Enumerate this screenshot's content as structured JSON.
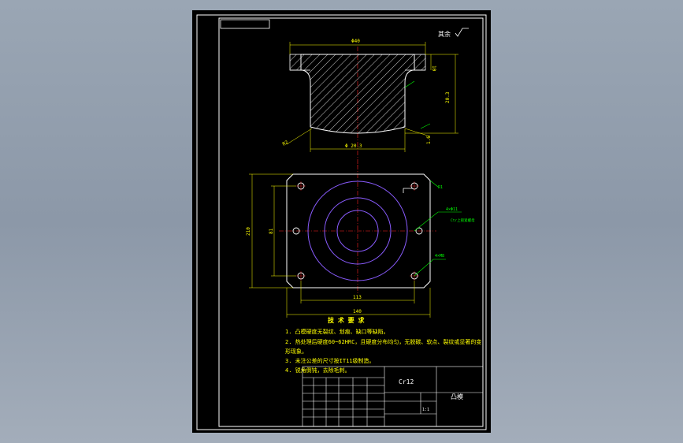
{
  "colors": {
    "background": "#8f9bab",
    "paper": "#000000",
    "frame": "#ffffff",
    "part_outline": "#ffffff",
    "dimension": "#ffff00",
    "note_text": "#ffff00",
    "center_line": "#ff2020",
    "circle": "#8a5cff",
    "leader": "#00ff00",
    "hatch": "#ffffff",
    "table": "#ffffff"
  },
  "drawing": {
    "surface_roughness": "其余",
    "section_dims": {
      "top_width": "Φ40",
      "flange_height": "10",
      "total_height": "20.3",
      "bottom_dia": "Φ 20.3",
      "left_radius": "R2",
      "right_ratio": "1.6"
    },
    "plan_dims": {
      "outer_height": "210",
      "hole_spacing_v": "81",
      "hole_spacing_h": "113",
      "outer_width": "140"
    },
    "callouts": {
      "hole_spec": "4×Φ11",
      "hole_note": "Ctr上锁紧螺母",
      "thread_label": "4×M8",
      "corner_label": "R1"
    },
    "notes": {
      "heading": "技 术 要 求",
      "items": [
        "1. 凸模硬度无裂纹、划痕、缺口等缺陷。",
        "2. 热处理后硬度60~62HRC，且硬度分布均匀，无脱碳、软点、裂纹或显著的变",
        "形现象。",
        "3. 未注公差的尺寸按IT11级制造。",
        "4. 锐角倒钝，去除毛刺。"
      ]
    },
    "title_block": {
      "material": "Cr12",
      "part_name": "凸模",
      "scale": "1:1"
    }
  }
}
